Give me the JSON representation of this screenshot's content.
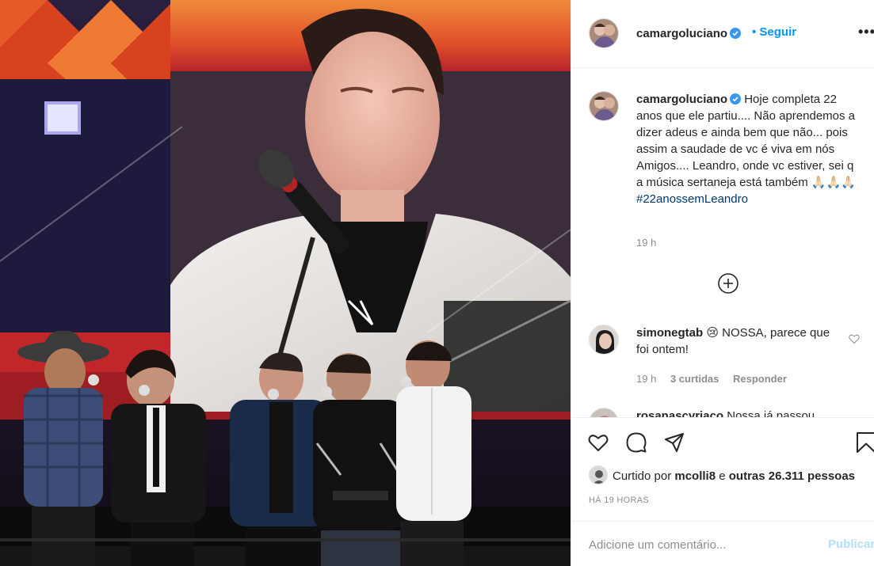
{
  "post": {
    "username": "camargoluciano",
    "follow_label": "Seguir",
    "more_label": "•••"
  },
  "caption": {
    "username": "camargoluciano",
    "text": "Hoje completa 22 anos que ele partiu.... Não aprendemos a dizer adeus e ainda bem que não... pois assim a saudade de vc é viva em nós Amigos.... Leandro, onde vc estiver, sei q a música sertaneja está também 🙏🏻🙏🏻🙏🏻",
    "hashtag": "#22anossemLeandro",
    "time": "19 h"
  },
  "comments": [
    {
      "username": "simonegtab",
      "text": "😢 NOSSA, parece que foi ontem!",
      "time": "19 h",
      "likes": "3 curtidas",
      "reply_label": "Responder"
    },
    {
      "username": "rosanascyriaco",
      "text": "Nossa já passou"
    }
  ],
  "likes": {
    "prefix": "Curtido por",
    "user": "mcolli8",
    "connector": "e",
    "others": "outras 26.311 pessoas"
  },
  "date": "HÁ 19 HORAS",
  "add_comment": {
    "placeholder": "Adicione um comentário...",
    "publish_label": "Publicar"
  },
  "icons": {
    "like": "heart-icon",
    "comment": "comment-bubble-icon",
    "share": "paper-plane-icon",
    "save": "bookmark-icon",
    "load_more": "plus-circle-icon",
    "verified": "verified-badge-icon"
  },
  "colors": {
    "link_blue": "#0095f6",
    "verified_blue": "#3897f0",
    "hashtag": "#00376b",
    "muted": "#8e8e8e"
  }
}
